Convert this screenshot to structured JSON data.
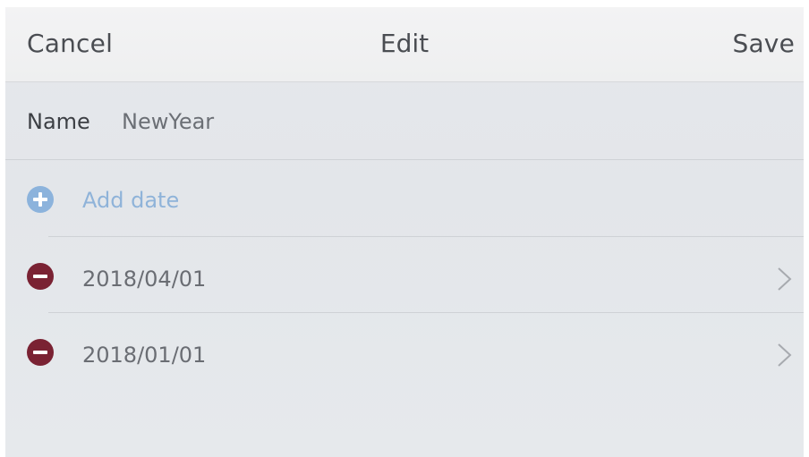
{
  "header": {
    "cancel_label": "Cancel",
    "title": "Edit",
    "save_label": "Save"
  },
  "name_row": {
    "label": "Name",
    "value": "NewYear"
  },
  "add_row": {
    "label": "Add date",
    "icon": "add-circle-icon"
  },
  "dates": [
    {
      "value": "2018/04/01",
      "icon": "remove-circle-icon"
    },
    {
      "value": "2018/01/01",
      "icon": "remove-circle-icon"
    }
  ],
  "colors": {
    "add_accent": "#8cb3dc",
    "remove_accent": "#7a2233"
  }
}
